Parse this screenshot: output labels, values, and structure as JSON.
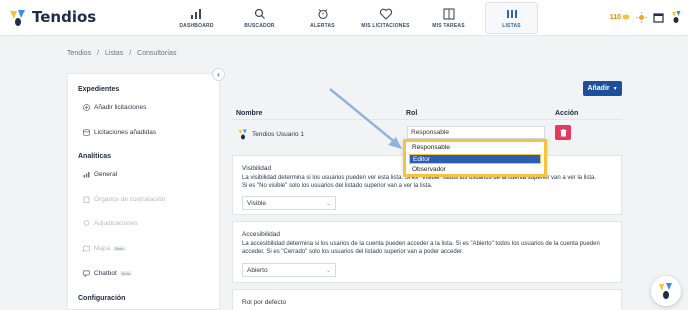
{
  "app": {
    "name": "Tendios"
  },
  "nav": [
    {
      "label": "DASHBOARD",
      "icon": "dashboard-icon",
      "active": false
    },
    {
      "label": "BUSCADOR",
      "icon": "search-icon",
      "active": false
    },
    {
      "label": "ALERTAS",
      "icon": "alarm-icon",
      "active": false
    },
    {
      "label": "MIS LICITACIONES",
      "icon": "heart-icon",
      "active": false
    },
    {
      "label": "MIS TAREAS",
      "icon": "board-icon",
      "active": false
    },
    {
      "label": "LISTAS",
      "icon": "lists-icon",
      "active": true
    }
  ],
  "topbar": {
    "coins": "110"
  },
  "breadcrumb": [
    "Tendios",
    "/",
    "Listas",
    "/",
    "Consultorías"
  ],
  "sidebar": {
    "expedientes_title": "Expedientes",
    "add_tenders": "Añadir licitaciones",
    "added_tenders": "Licitaciones añadidas",
    "analytics_title": "Analíticas",
    "general": "General",
    "organos": "Órganos de contratación",
    "adjudicaciones": "Adjudicaciones",
    "mapa": "Mapa",
    "mapa_badge": "Beta",
    "chatbot": "Chatbot",
    "chatbot_badge": "Beta",
    "config_title": "Configuración"
  },
  "main": {
    "add_button": "Añadir",
    "columns": {
      "name": "Nombre",
      "role": "Rol",
      "action": "Acción"
    },
    "user": {
      "name": "Tendios Usuario 1",
      "role": "Responsable"
    },
    "visibility": {
      "title": "Visibilidad",
      "desc1": "La visibilidad determina si los usuarios pueden ver esta lista. Si es \"Visible\" todos los usuarios de la cuenta superior van a ver la lista.",
      "desc2": "Si es \"No visible\" solo los usuarios del listado superior van a ver la lista.",
      "value": "Visible"
    },
    "accessibility": {
      "title": "Accesibilidad",
      "desc1": "La accesibilidad determina si los usarios de la cuenta pueden acceder a la lista. Si es \"Abierto\" todos los usuarios de la cuenta pueden",
      "desc2": "acceder. Si es \"Cerrado\" solo los usuarios del listado superior van a poder acceder.",
      "value": "Abierto"
    },
    "default_role": {
      "title": "Rol por defecto"
    }
  },
  "dropdown": {
    "options": [
      "Responsable",
      "Editor",
      "Observador"
    ],
    "selected": "Editor"
  },
  "colors": {
    "primary": "#1d4f9c",
    "highlight": "#f5c242",
    "danger": "#e33a62",
    "arrow": "#8fb4e0"
  }
}
